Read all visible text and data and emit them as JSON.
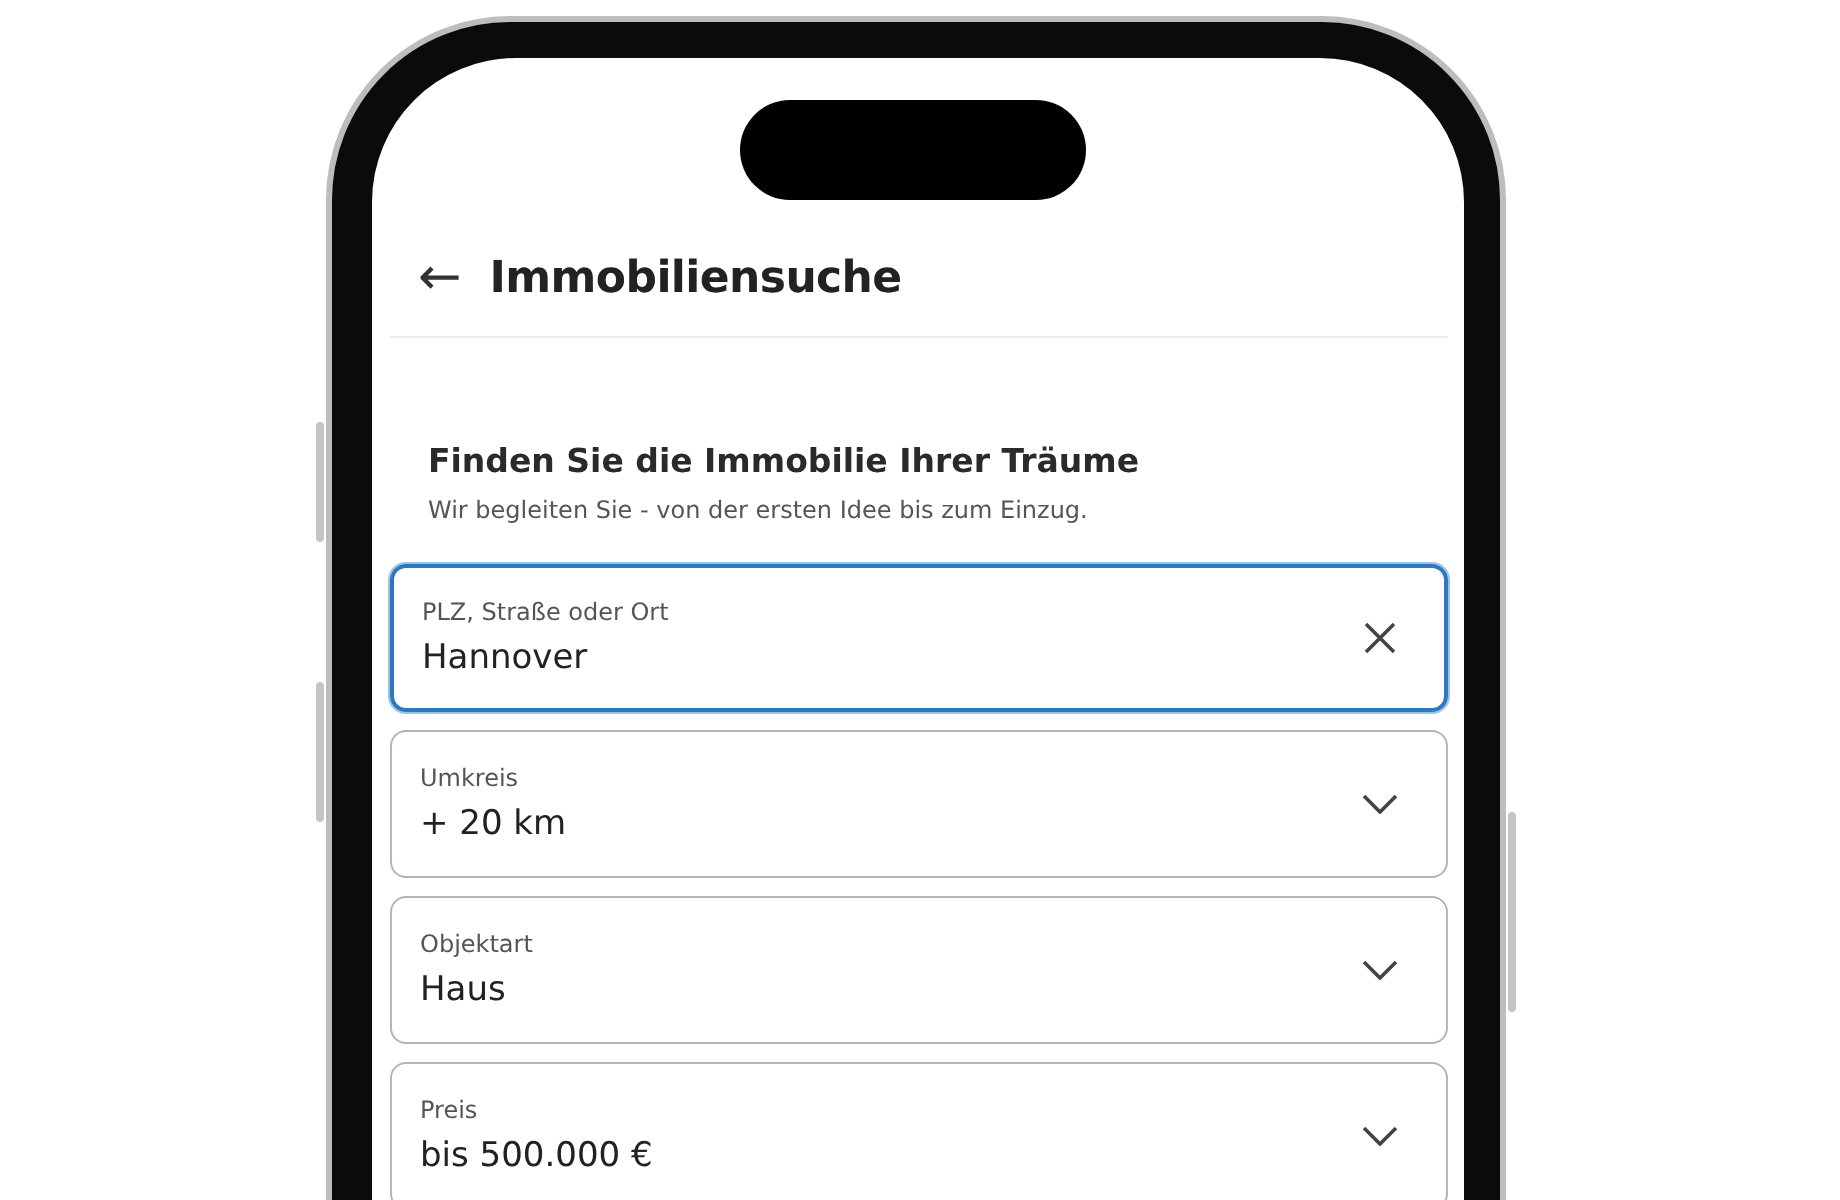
{
  "header": {
    "back_icon_char": "←",
    "title": "Immobiliensuche"
  },
  "intro": {
    "heading": "Finden Sie die Immobilie Ihrer Träume",
    "subtitle": "Wir begleiten Sie - von der ersten Idee bis zum Einzug."
  },
  "fields": [
    {
      "kind": "clear",
      "label": "PLZ, Straße oder Ort",
      "value": "Hannover",
      "focused": true
    },
    {
      "kind": "dropdown",
      "label": "Umkreis",
      "value": "+ 20 km",
      "focused": false
    },
    {
      "kind": "dropdown",
      "label": "Objektart",
      "value": "Haus",
      "focused": false
    },
    {
      "kind": "dropdown",
      "label": "Preis",
      "value": "bis 500.000 €",
      "focused": false
    }
  ]
}
